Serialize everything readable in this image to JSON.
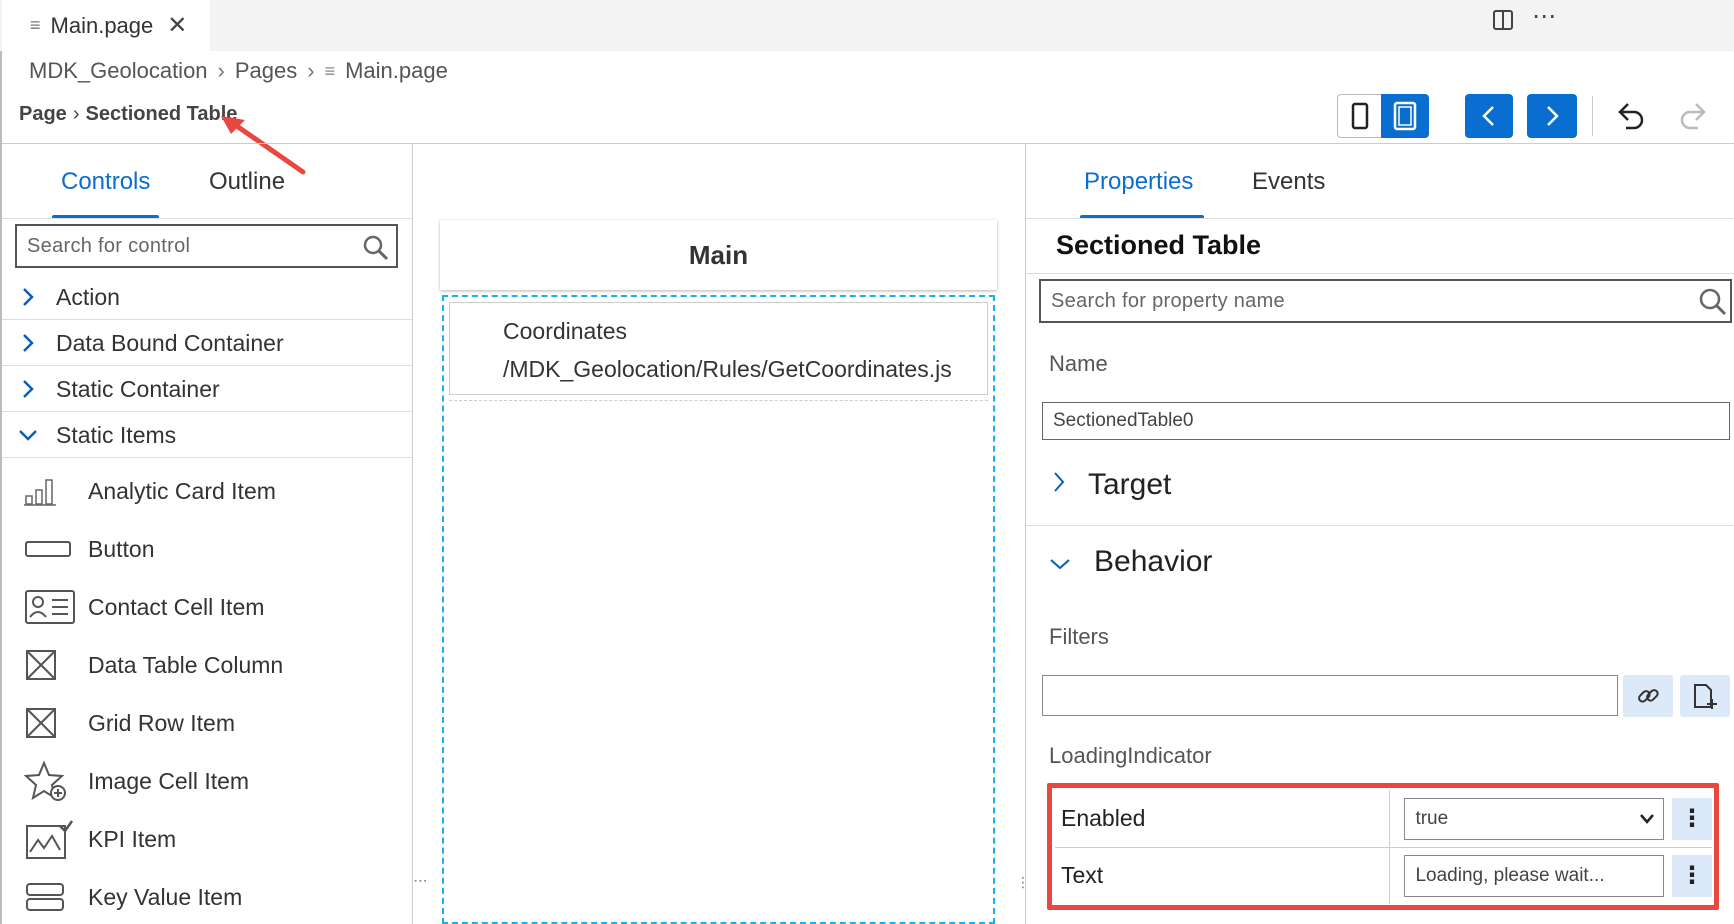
{
  "editor_tab": {
    "title": "Main.page"
  },
  "breadcrumb": {
    "items": [
      "MDK_Geolocation",
      "Pages",
      "Main.page"
    ]
  },
  "page_path": {
    "root": "Page",
    "current": "Sectioned Table"
  },
  "left_panel": {
    "tabs": [
      "Controls",
      "Outline"
    ],
    "search_placeholder": "Search for control",
    "groups": [
      "Action",
      "Data Bound Container",
      "Static Container",
      "Static Items"
    ],
    "items": [
      "Analytic Card Item",
      "Button",
      "Contact Cell Item",
      "Data Table Column",
      "Grid Row Item",
      "Image Cell Item",
      "KPI Item",
      "Key Value Item"
    ]
  },
  "canvas": {
    "page_title": "Main",
    "cell_title": "Coordinates",
    "cell_subtitle": "/MDK_Geolocation/Rules/GetCoordinates.js"
  },
  "right_panel": {
    "tabs": [
      "Properties",
      "Events"
    ],
    "title": "Sectioned Table",
    "search_placeholder": "Search for property name",
    "name_label": "Name",
    "name_value": "SectionedTable0",
    "section_target": "Target",
    "section_behavior": "Behavior",
    "filters_label": "Filters",
    "filters_value": "",
    "loading_label": "LoadingIndicator",
    "enabled_key": "Enabled",
    "enabled_value": "true",
    "text_key": "Text",
    "text_value": "Loading, please wait..."
  },
  "colors": {
    "accent": "#0a6ed1",
    "highlight": "#e8483f",
    "selection": "#1ab0e8"
  }
}
